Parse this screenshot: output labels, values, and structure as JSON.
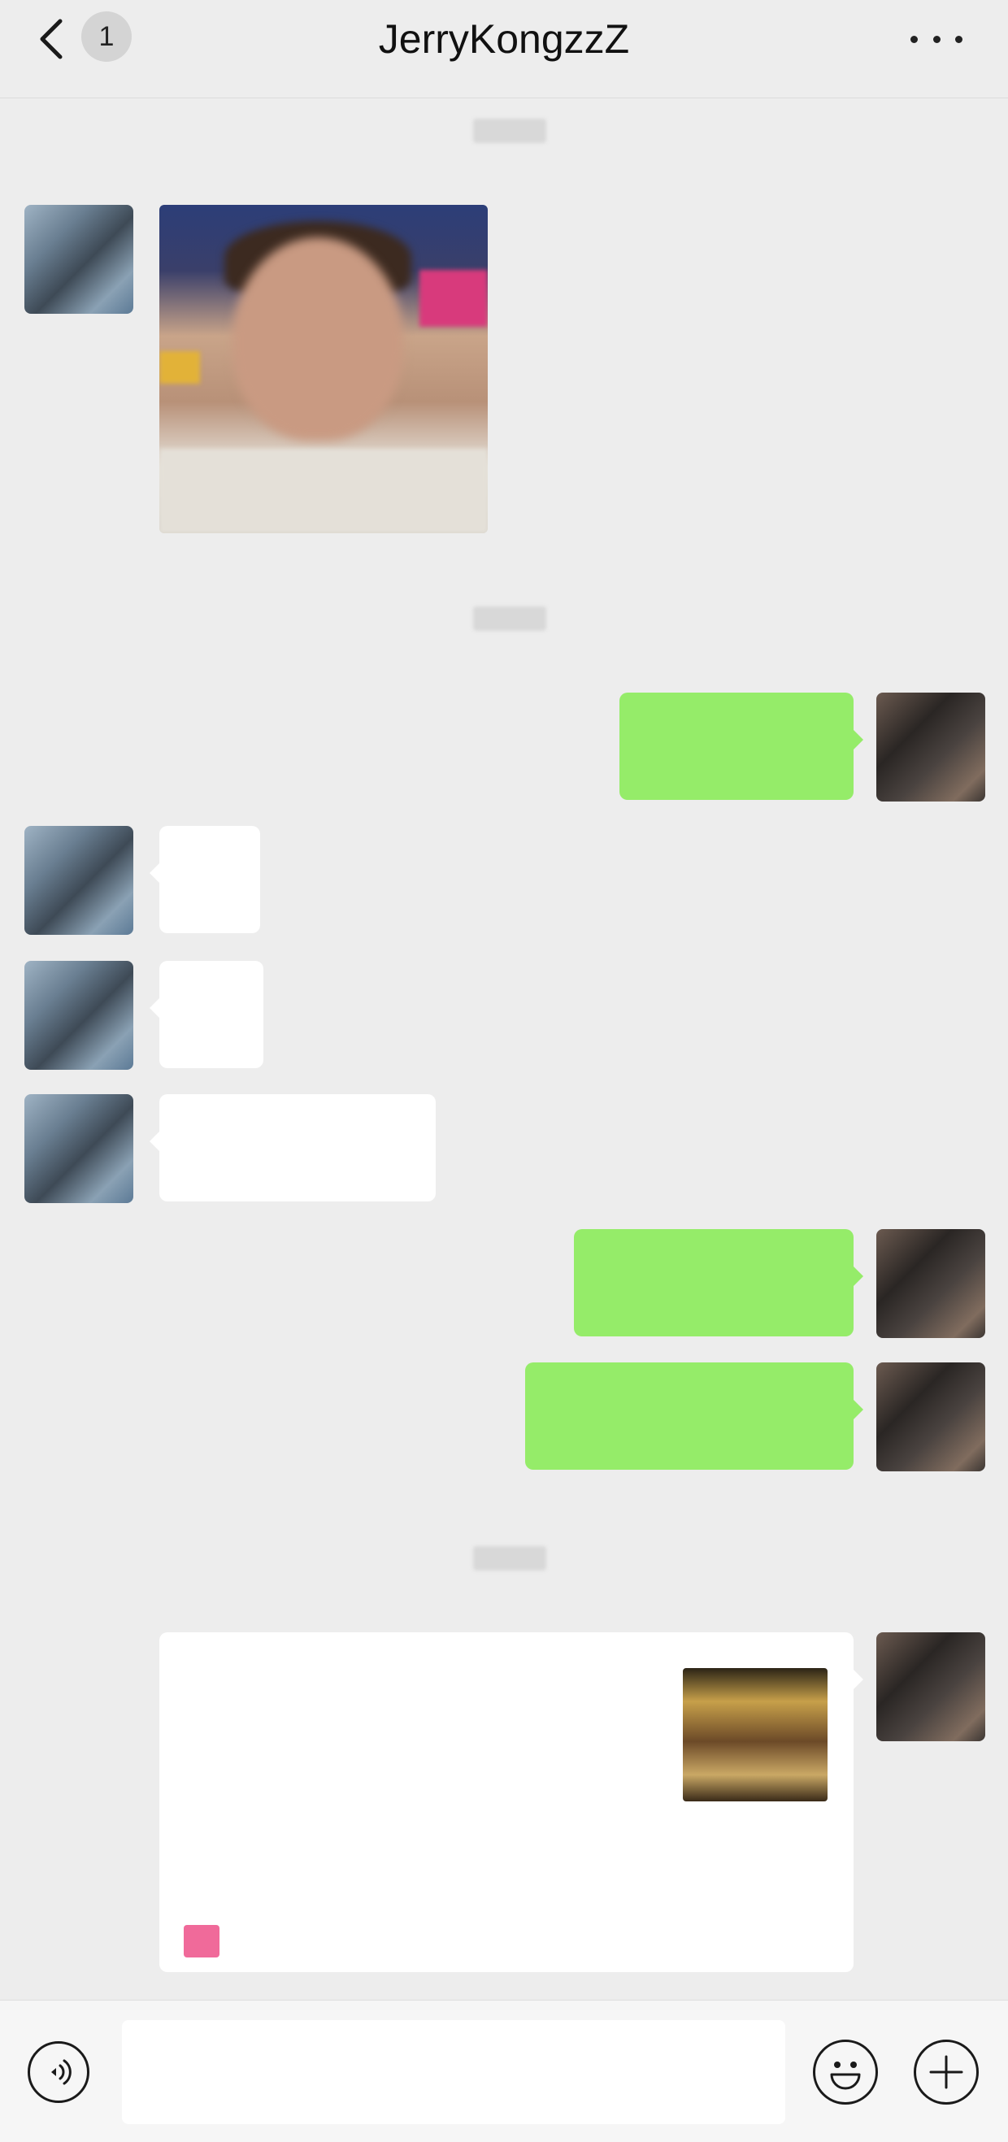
{
  "header": {
    "back_icon": "chevron-left-icon",
    "unread_count": "1",
    "title": "JerryKongzzZ",
    "more_icon": "more-dots-icon"
  },
  "messages": {
    "stamp_1": "",
    "stamp_2": "",
    "stamp_3": "",
    "out_1": "",
    "in_1": "",
    "in_2": "",
    "in_3": "",
    "out_2": "",
    "out_3": ""
  },
  "card": {
    "title": "",
    "desc_1": "",
    "desc_2": "",
    "app_name": ""
  },
  "input_bar": {
    "voice_icon": "voice-icon",
    "emoji_icon": "emoji-icon",
    "plus_icon": "plus-icon",
    "placeholder": ""
  },
  "colors": {
    "background": "#ededed",
    "outgoing_bubble": "#95ec69",
    "incoming_bubble": "#ffffff"
  }
}
